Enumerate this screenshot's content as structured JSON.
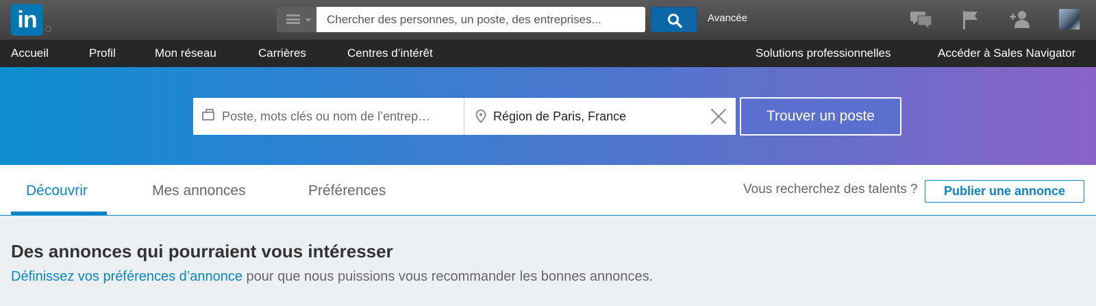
{
  "topbar": {
    "logo_text": "in",
    "search_placeholder": "Chercher des personnes, un poste, des entreprises...",
    "advanced_label": "Avancée",
    "icons": [
      "messages-icon",
      "flag-icon",
      "add-connection-icon",
      "avatar"
    ]
  },
  "nav": {
    "left": [
      "Accueil",
      "Profil",
      "Mon réseau",
      "Carrières",
      "Centres d’intérêt"
    ],
    "right": [
      "Solutions professionnelles",
      "Accéder à Sales Navigator"
    ]
  },
  "jobsearch": {
    "keywords_placeholder": "Poste, mots clés ou nom de l’entrep…",
    "keywords_value": "",
    "location_value": "Région de Paris, France",
    "submit_label": "Trouver un poste"
  },
  "tabs": {
    "items": [
      "Découvrir",
      "Mes annonces",
      "Préférences"
    ],
    "active": "Découvrir",
    "talent_question": "Vous recherchez des talents ?",
    "post_job_label": "Publier une annonce"
  },
  "content": {
    "title": "Des annonces qui pourraient vous intéresser",
    "link_text": "Définissez vos préférences d’annonce",
    "desc_rest": " pour que nous puissions vous recommander les bonnes annonces."
  },
  "colors": {
    "linkedin_blue": "#0077b5",
    "accent": "#0a84c4",
    "search_button": "#0b67a7",
    "find_button": "#5b6fcf"
  }
}
